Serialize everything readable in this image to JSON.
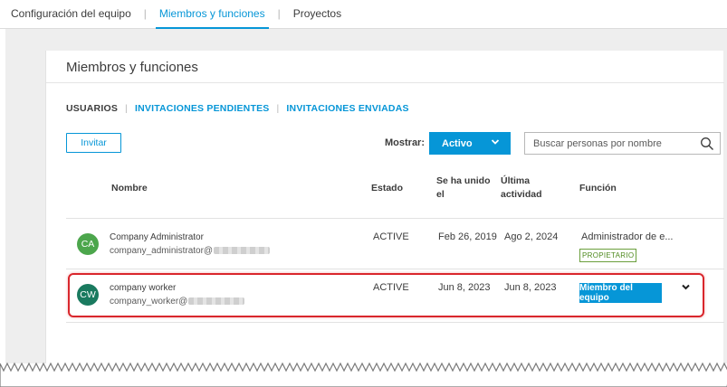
{
  "top_nav": {
    "tabs": [
      {
        "label": "Configuración del equipo",
        "active": false
      },
      {
        "label": "Miembros y funciones",
        "active": true
      },
      {
        "label": "Proyectos",
        "active": false
      }
    ]
  },
  "panel": {
    "title": "Miembros y funciones",
    "subtabs": [
      {
        "label": "USUARIOS",
        "active": true
      },
      {
        "label": "INVITACIONES PENDIENTES",
        "active": false
      },
      {
        "label": "INVITACIONES ENVIADAS",
        "active": false
      }
    ]
  },
  "toolbar": {
    "invite_label": "Invitar",
    "show_label": "Mostrar:",
    "status_value": "Activo",
    "search_placeholder": "Buscar personas por nombre"
  },
  "table": {
    "headers": {
      "name": "Nombre",
      "status": "Estado",
      "joined_line1": "Se ha unido",
      "joined_line2": "el",
      "activity_line1": "Última",
      "activity_line2": "actividad",
      "role": "Función"
    },
    "rows": [
      {
        "initials": "CA",
        "avatar_color": "#4ca64c",
        "name": "Company Administrator",
        "email_prefix": "company_administrator@",
        "status": "ACTIVE",
        "joined": "Feb 26, 2019",
        "last_activity": "Ago 2, 2024",
        "role": "Administrador de e...",
        "badge": "PROPIETARIO"
      },
      {
        "initials": "CW",
        "avatar_color": "#1a7a5f",
        "name": "company worker",
        "email_prefix": "company_worker@",
        "status": "ACTIVE",
        "joined": "Jun 8, 2023",
        "last_activity": "Jun 8, 2023",
        "role": "Miembro del equipo"
      }
    ]
  },
  "colors": {
    "accent": "#0696d7",
    "highlight": "#d9262c",
    "owner_badge": "#6a9f3c"
  }
}
